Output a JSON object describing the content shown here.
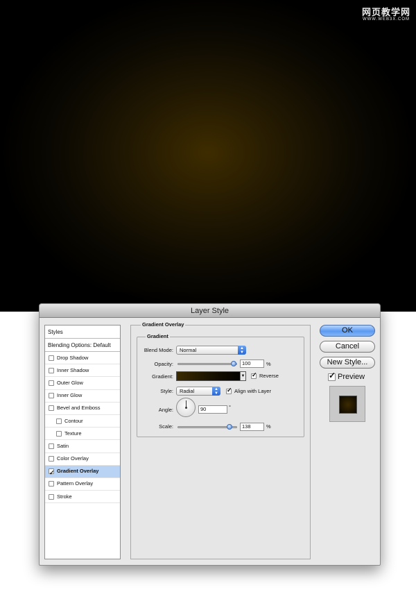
{
  "watermark": {
    "title": "网页教学网",
    "url": "WWW.WEB3X.COM"
  },
  "dialog": {
    "title": "Layer Style",
    "styles_list": {
      "header": "Styles",
      "blending": "Blending Options: Default",
      "items": [
        {
          "label": "Drop Shadow",
          "checked": false,
          "indent": false,
          "selected": false
        },
        {
          "label": "Inner Shadow",
          "checked": false,
          "indent": false,
          "selected": false
        },
        {
          "label": "Outer Glow",
          "checked": false,
          "indent": false,
          "selected": false
        },
        {
          "label": "Inner Glow",
          "checked": false,
          "indent": false,
          "selected": false
        },
        {
          "label": "Bevel and Emboss",
          "checked": false,
          "indent": false,
          "selected": false
        },
        {
          "label": "Contour",
          "checked": false,
          "indent": true,
          "selected": false
        },
        {
          "label": "Texture",
          "checked": false,
          "indent": true,
          "selected": false
        },
        {
          "label": "Satin",
          "checked": false,
          "indent": false,
          "selected": false
        },
        {
          "label": "Color Overlay",
          "checked": false,
          "indent": false,
          "selected": false
        },
        {
          "label": "Gradient Overlay",
          "checked": true,
          "indent": false,
          "selected": true
        },
        {
          "label": "Pattern Overlay",
          "checked": false,
          "indent": false,
          "selected": false
        },
        {
          "label": "Stroke",
          "checked": false,
          "indent": false,
          "selected": false
        }
      ]
    },
    "panel": {
      "section_title": "Gradient Overlay",
      "group_title": "Gradient",
      "blend_mode": {
        "label": "Blend Mode:",
        "value": "Normal"
      },
      "opacity": {
        "label": "Opacity:",
        "value": "100",
        "unit": "%",
        "level": 100
      },
      "gradient": {
        "label": "Gradient:",
        "reverse_label": "Reverse",
        "reverse_checked": true
      },
      "style": {
        "label": "Style:",
        "value": "Radial",
        "align_label": "Align with Layer",
        "align_checked": true
      },
      "angle": {
        "label": "Angle:",
        "value": "90",
        "unit": "°"
      },
      "scale": {
        "label": "Scale:",
        "value": "138",
        "unit": "%",
        "level": 92
      }
    },
    "buttons": {
      "ok": "OK",
      "cancel": "Cancel",
      "new_style": "New Style...",
      "preview_label": "Preview",
      "preview_checked": true
    }
  },
  "colors": {
    "canvas_center": "#3e2c00",
    "canvas_edge": "#000000",
    "selection": "#b8d3f4",
    "accent": "#2867d6"
  }
}
